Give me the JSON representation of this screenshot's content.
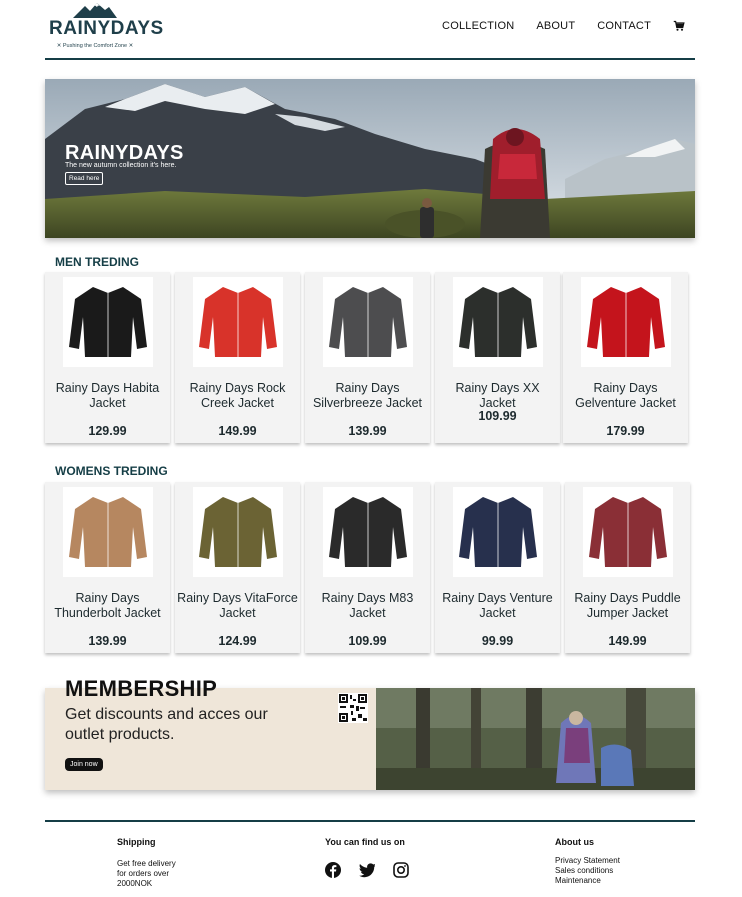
{
  "brand": {
    "name": "RAINYDAYS",
    "tagline": "✕ Pushing the Comfort Zone ✕"
  },
  "nav": {
    "items": [
      "COLLECTION",
      "ABOUT",
      "CONTACT"
    ],
    "cart_icon": "cart-icon"
  },
  "hero": {
    "title": "RAINYDAYS",
    "subtitle": "The new autumn collection it's here.",
    "button": "Read here"
  },
  "men": {
    "title": "MEN TREDING",
    "products": [
      {
        "name": "Rainy Days Habita Jacket",
        "price": "129.99",
        "color": "#1a1a1a"
      },
      {
        "name": "Rainy Days Rock Creek Jacket",
        "price": "149.99",
        "color": "#d8332a"
      },
      {
        "name": "Rainy Days Silverbreeze Jacket",
        "price": "139.99",
        "color": "#4d4d4f"
      },
      {
        "name": "Rainy Days XX Jacket",
        "price": "109.99",
        "color": "#2c2f2c"
      },
      {
        "name": "Rainy Days Gelventure Jacket",
        "price": "179.99",
        "color": "#c4141c"
      }
    ]
  },
  "women": {
    "title": "WOMENS TREDING",
    "products": [
      {
        "name": "Rainy Days Thunderbolt Jacket",
        "price": "139.99",
        "color": "#b68760"
      },
      {
        "name": "Rainy Days VitaForce Jacket",
        "price": "124.99",
        "color": "#6b6334"
      },
      {
        "name": "Rainy Days M83 Jacket",
        "price": "109.99",
        "color": "#2a2a2a"
      },
      {
        "name": "Rainy Days Venture Jacket",
        "price": "99.99",
        "color": "#27304d"
      },
      {
        "name": "Rainy Days Puddle Jumper Jacket",
        "price": "149.99",
        "color": "#8a2f36"
      }
    ]
  },
  "membership": {
    "title": "MEMBERSHIP",
    "text": "Get discounts and acces our outlet products.",
    "button": "Join now"
  },
  "footer": {
    "shipping": {
      "title": "Shipping",
      "lines": [
        "Get free delivery",
        "for orders over",
        "2000NOK"
      ]
    },
    "social": {
      "title": "You can find us on",
      "icons": [
        "facebook-icon",
        "twitter-icon",
        "instagram-icon"
      ]
    },
    "about": {
      "title": "About us",
      "links": [
        "Privacy Statement",
        "Sales conditions",
        "Maintenance"
      ]
    }
  }
}
